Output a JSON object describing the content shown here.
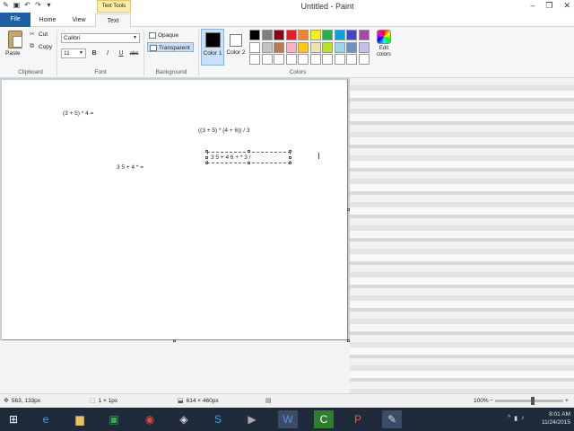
{
  "window": {
    "title": "Untitled - Paint",
    "context_tab": "Text Tools",
    "min": "–",
    "max": "❐",
    "close": "✕"
  },
  "tabs": {
    "file": "File",
    "home": "Home",
    "view": "View",
    "text": "Text"
  },
  "clipboard": {
    "paste": "Paste",
    "cut": "Cut",
    "copy": "Copy",
    "label": "Clipboard"
  },
  "font": {
    "family": "Calibri",
    "size": "11",
    "bold": "B",
    "italic": "I",
    "underline": "U",
    "strike": "abc",
    "label": "Font"
  },
  "background": {
    "opaque": "Opaque",
    "transparent": "Transparent",
    "label": "Background"
  },
  "colors": {
    "color1_label": "Color 1",
    "color2_label": "Color 2",
    "edit_label": "Edit colors",
    "label": "Colors",
    "palette": [
      "#000000",
      "#7f7f7f",
      "#880015",
      "#ed1c24",
      "#ff7f27",
      "#fff200",
      "#22b14c",
      "#00a2e8",
      "#3f48cc",
      "#a349a4",
      "#ffffff",
      "#c3c3c3",
      "#b97a57",
      "#ffaec9",
      "#ffc90e",
      "#efe4b0",
      "#b5e61d",
      "#99d9ea",
      "#7092be",
      "#c8bfe7",
      "#ffffff",
      "#ffffff",
      "#ffffff",
      "#ffffff",
      "#ffffff",
      "#ffffff",
      "#ffffff",
      "#ffffff",
      "#ffffff",
      "#ffffff"
    ]
  },
  "canvas": {
    "expr1": "(3 + 5) * 4 =",
    "expr2": "((3 + 5) * (4 + 6)) / 3",
    "expr3": "3 5 + 4 * =",
    "textbox": "3 5 + 4 6 + * 3 /"
  },
  "status": {
    "cursor": "563, 133px",
    "selection": "1 × 1px",
    "canvas_size": "614 × 460px",
    "zoom": "100%"
  },
  "taskbar": {
    "time": "8:01 AM",
    "date": "11/24/2015"
  }
}
